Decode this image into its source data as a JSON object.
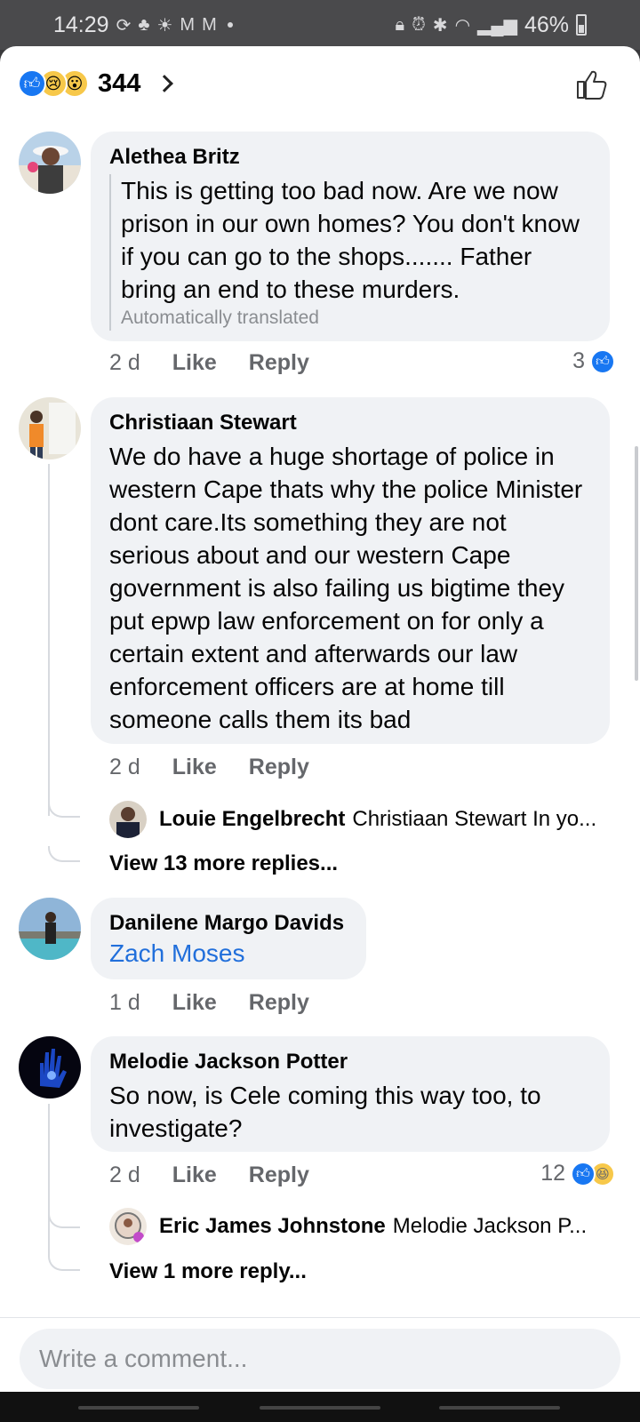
{
  "status_bar": {
    "time": "14:29",
    "battery": "46%"
  },
  "reactions": {
    "count": "344"
  },
  "comments": [
    {
      "author": "Alethea Britz",
      "text": "This is getting too bad now. Are we now prison in our own homes? You don't know if you can go to the shops....... Father bring an end to these murders.",
      "translated_label": "Automatically translated",
      "time": "2 d",
      "like": "Like",
      "reply": "Reply",
      "reaction_count": "3"
    },
    {
      "author": "Christiaan Stewart",
      "text": "We do have a huge shortage of police in western Cape thats why the police Minister dont care.Its something they are not serious about and our western Cape government is also failing us bigtime they put epwp law enforcement on for only a certain extent and afterwards our law enforcement officers are at home till someone calls them its bad",
      "time": "2 d",
      "like": "Like",
      "reply": "Reply",
      "reply_preview": {
        "author": "Louie Engelbrecht",
        "text": "Christiaan Stewart In yo..."
      },
      "more_replies": "View 13 more replies..."
    },
    {
      "author": "Danilene Margo Davids",
      "text": "Zach Moses",
      "time": "1 d",
      "like": "Like",
      "reply": "Reply"
    },
    {
      "author": "Melodie Jackson Potter",
      "text": "So now, is Cele coming this way too, to investigate?",
      "time": "2 d",
      "like": "Like",
      "reply": "Reply",
      "reaction_count": "12",
      "reply_preview": {
        "author": "Eric James Johnstone",
        "text": "Melodie Jackson P..."
      },
      "more_replies": "View 1 more reply..."
    }
  ],
  "composer": {
    "placeholder": "Write a comment..."
  },
  "colors": {
    "accent": "#1877f2",
    "link": "#216fdb",
    "bubble": "#f0f2f5"
  }
}
